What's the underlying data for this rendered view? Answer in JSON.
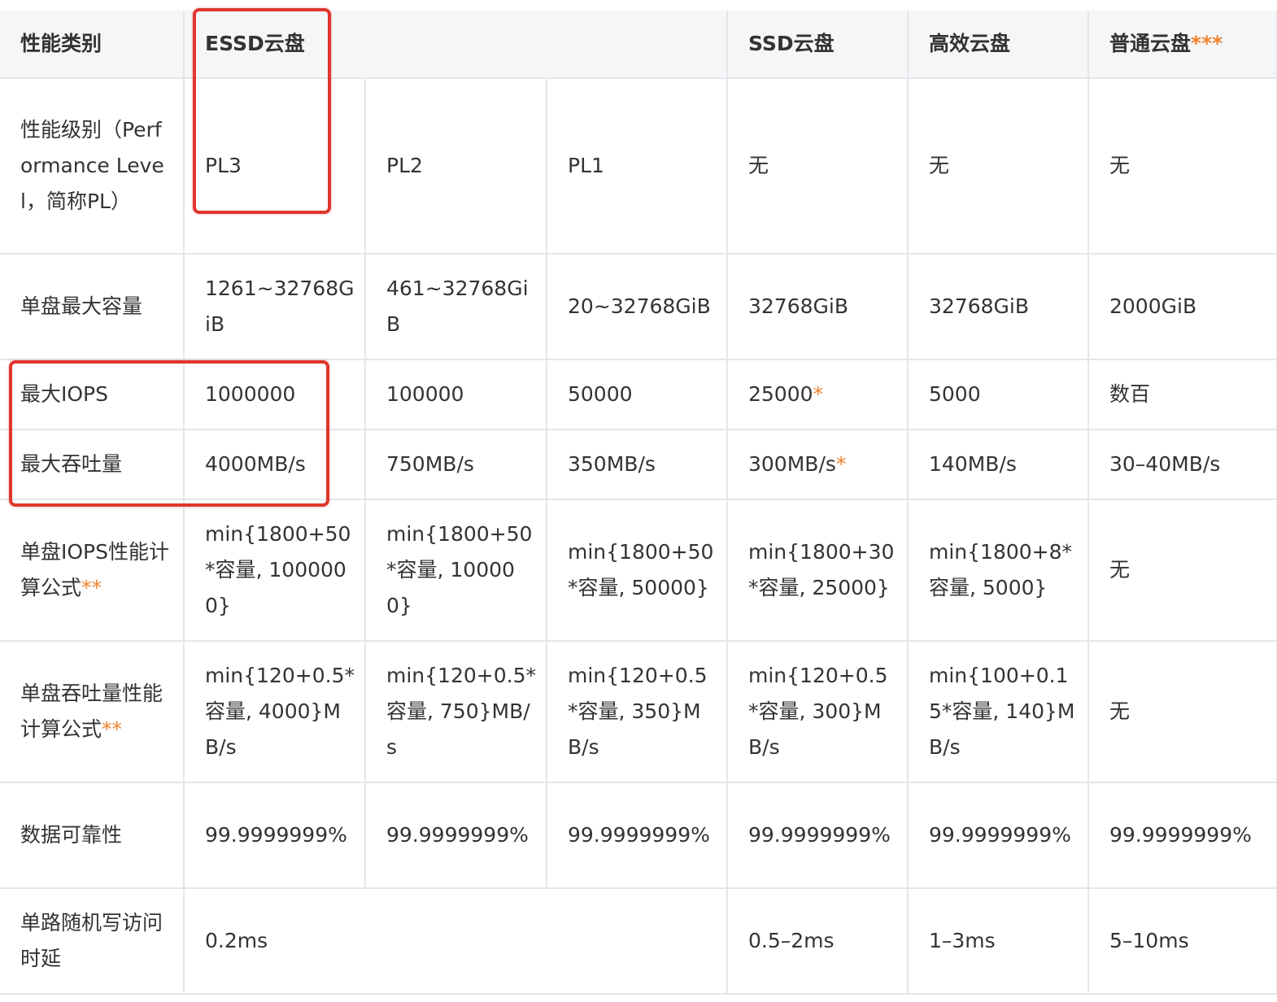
{
  "header": {
    "category": "性能类别",
    "essd": "ESSD云盘",
    "ssd": "SSD云盘",
    "efficient": "高效云盘",
    "basic": "普通云盘",
    "basic_note": "***"
  },
  "rows": {
    "level": {
      "label": "性能级别（Performance Level，简称PL）",
      "pl3": "PL3",
      "pl2": "PL2",
      "pl1": "PL1",
      "ssd": "无",
      "efficient": "无",
      "basic": "无"
    },
    "capacity": {
      "label": "单盘最大容量",
      "pl3": "1261~32768GiB",
      "pl2": "461~32768GiB",
      "pl1": "20~32768GiB",
      "ssd": "32768GiB",
      "efficient": "32768GiB",
      "basic": "2000GiB"
    },
    "iops": {
      "label": "最大IOPS",
      "pl3": "1000000",
      "pl2": "100000",
      "pl1": "50000",
      "ssd": "25000",
      "ssd_note": "*",
      "efficient": "5000",
      "basic": "数百"
    },
    "throughput": {
      "label": "最大吞吐量",
      "pl3": "4000MB/s",
      "pl2": "750MB/s",
      "pl1": "350MB/s",
      "ssd": "300MB/s",
      "ssd_note": "*",
      "efficient": "140MB/s",
      "basic": "30–40MB/s"
    },
    "iops_formula": {
      "label": "单盘IOPS性能计算公式",
      "label_note": "**",
      "pl3": "min{1800+50*容量, 1000000}",
      "pl2": "min{1800+50*容量, 100000}",
      "pl1": "min{1800+50*容量, 50000}",
      "ssd": "min{1800+30*容量, 25000}",
      "efficient": "min{1800+8*容量, 5000}",
      "basic": "无"
    },
    "throughput_formula": {
      "label": "单盘吞吐量性能计算公式",
      "label_note": "**",
      "pl3": "min{120+0.5*容量, 4000}MB/s",
      "pl2": "min{120+0.5*容量, 750}MB/s",
      "pl1": "min{120+0.5*容量, 350}MB/s",
      "ssd": "min{120+0.5*容量, 300}MB/s",
      "efficient": "min{100+0.15*容量, 140}MB/s",
      "basic": "无"
    },
    "reliability": {
      "label": "数据可靠性",
      "pl3": "99.9999999%",
      "pl2": "99.9999999%",
      "pl1": "99.9999999%",
      "ssd": "99.9999999%",
      "efficient": "99.9999999%",
      "basic": "99.9999999%"
    },
    "latency": {
      "label": "单路随机写访问时延",
      "essd": "0.2ms",
      "ssd": "0.5–2ms",
      "efficient": "1–3ms",
      "basic": "5–10ms"
    }
  },
  "colors": {
    "highlight": "#e0362d",
    "note_star": "#f0802a",
    "header_bg": "#f5f6f8"
  }
}
